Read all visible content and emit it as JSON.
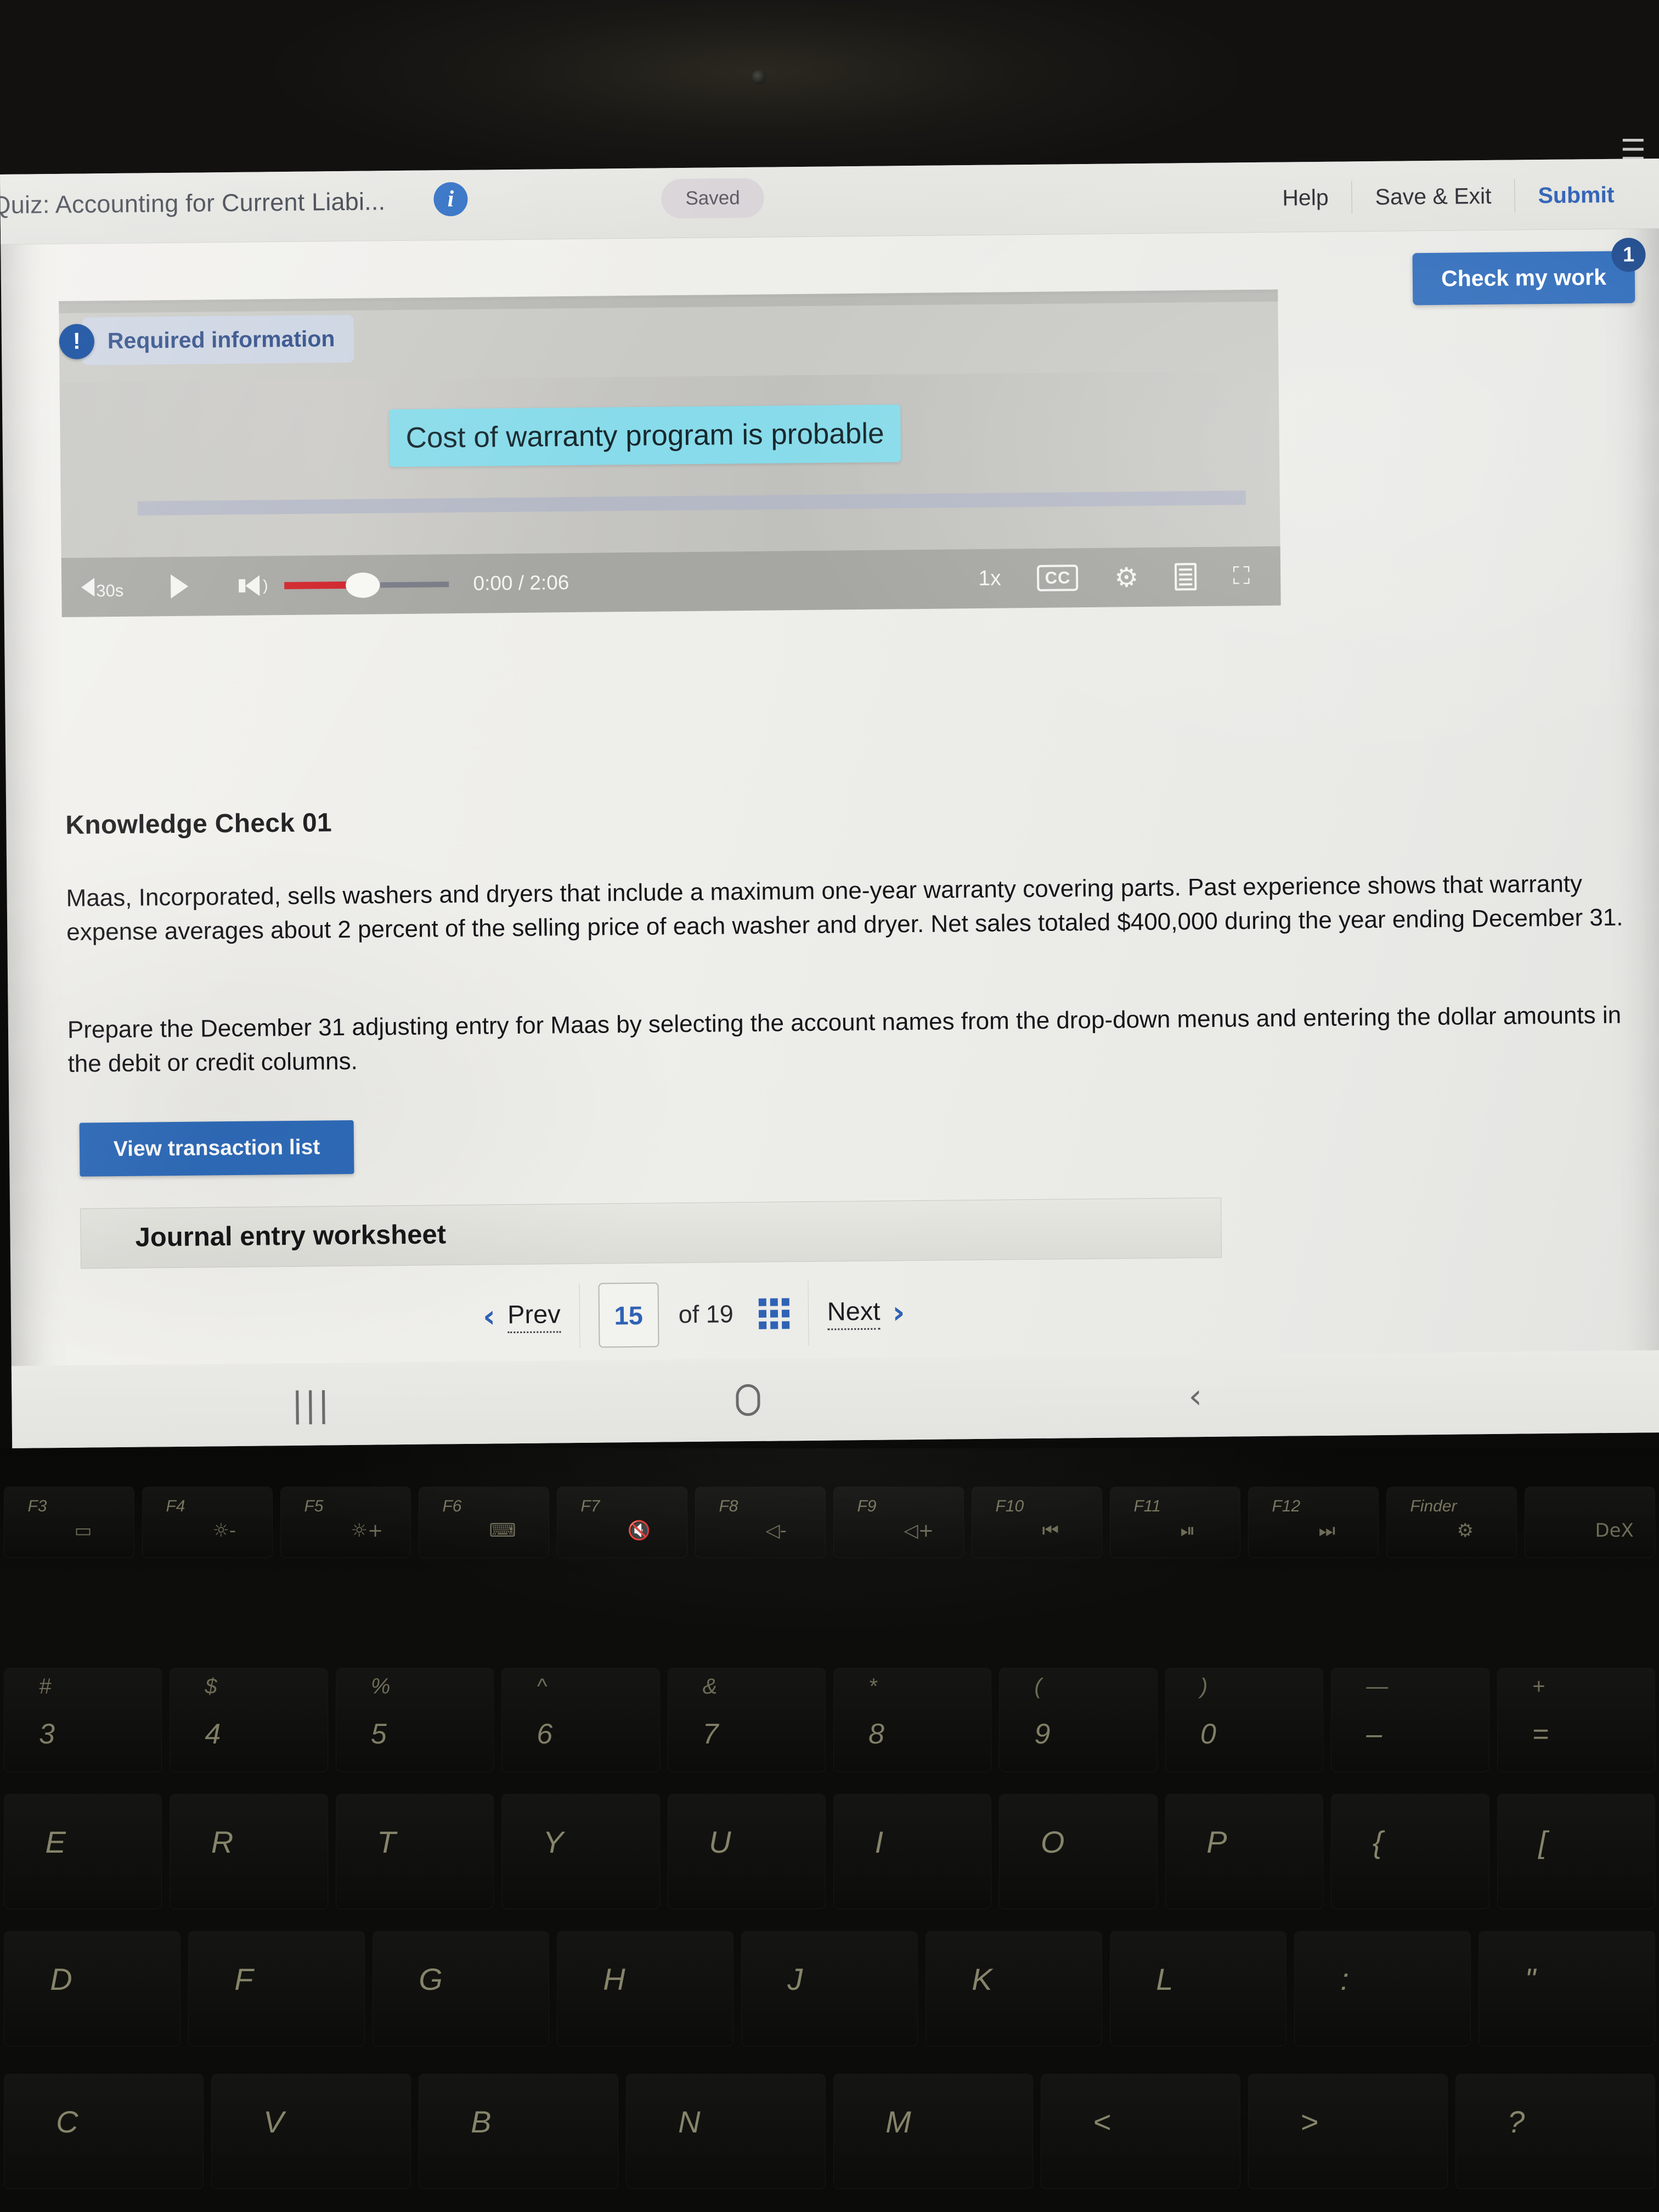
{
  "device": {
    "status_icons": [
      "wifi-icon"
    ]
  },
  "appbar": {
    "title": "Quiz: Accounting for Current Liabi...",
    "info_icon": "i",
    "saved_label": "Saved",
    "help_label": "Help",
    "save_exit_label": "Save & Exit",
    "submit_label": "Submit"
  },
  "check_my_work": {
    "label": "Check my work",
    "badge": "1",
    "color": "#2f6cbb"
  },
  "video": {
    "required_badge": "!",
    "required_label": "Required information",
    "caption": "Cost of warranty program is probable",
    "caption_bg": "#88dbea",
    "rewind_label": "30s",
    "current_time": "0:00",
    "separator": "/",
    "duration": "2:06",
    "speed_label": "1x",
    "cc_label": "CC",
    "volume_color": "#cf2027"
  },
  "content": {
    "heading": "Knowledge Check 01",
    "paragraph_1": "Maas, Incorporated, sells washers and dryers that include a maximum one-year warranty covering parts. Past experience shows that warranty expense averages about 2 percent of the selling price of each washer and dryer. Net sales totaled $400,000 during the year ending December 31.",
    "paragraph_2": "Prepare the December 31 adjusting entry for Maas by selecting the account names from the drop-down menus and entering the dollar amounts in the debit or credit columns.",
    "view_transaction_label": "View transaction list",
    "worksheet_title": "Journal entry worksheet"
  },
  "pager": {
    "prev_label": "Prev",
    "current_page": "15",
    "of_label": "of 19",
    "next_label": "Next"
  },
  "navbar": {
    "recents_icon": "|||",
    "home_icon": "home-pill",
    "back_icon": "‹"
  },
  "keyboard": {
    "function_row": [
      {
        "fn": "F3",
        "icon": "▭"
      },
      {
        "fn": "F4",
        "icon": "☼-"
      },
      {
        "fn": "F5",
        "icon": "☼+"
      },
      {
        "fn": "F6",
        "icon": "⌨"
      },
      {
        "fn": "F7",
        "icon": "🔇"
      },
      {
        "fn": "F8",
        "icon": "◁-"
      },
      {
        "fn": "F9",
        "icon": "◁+"
      },
      {
        "fn": "F10",
        "icon": "⏮"
      },
      {
        "fn": "F11",
        "icon": "⏯"
      },
      {
        "fn": "F12",
        "icon": "⏭"
      },
      {
        "fn": "Finder",
        "icon": "⚙"
      },
      {
        "fn": "",
        "icon": "DeX"
      }
    ],
    "number_row": [
      {
        "top": "#",
        "main": "3"
      },
      {
        "top": "$",
        "main": "4"
      },
      {
        "top": "%",
        "main": "5"
      },
      {
        "top": "^",
        "main": "6"
      },
      {
        "top": "&",
        "main": "7"
      },
      {
        "top": "*",
        "main": "8"
      },
      {
        "top": "(",
        "main": "9"
      },
      {
        "top": ")",
        "main": "0"
      },
      {
        "top": "—",
        "main": "–"
      },
      {
        "top": "+",
        "main": "="
      }
    ],
    "row_q": [
      "E",
      "R",
      "T",
      "Y",
      "U",
      "I",
      "O",
      "P",
      "{",
      "["
    ],
    "row_a": [
      "D",
      "F",
      "G",
      "H",
      "J",
      "K",
      "L",
      ":",
      "\""
    ],
    "row_z": [
      "C",
      "V",
      "B",
      "N",
      "M",
      "<",
      ">",
      "?"
    ]
  }
}
